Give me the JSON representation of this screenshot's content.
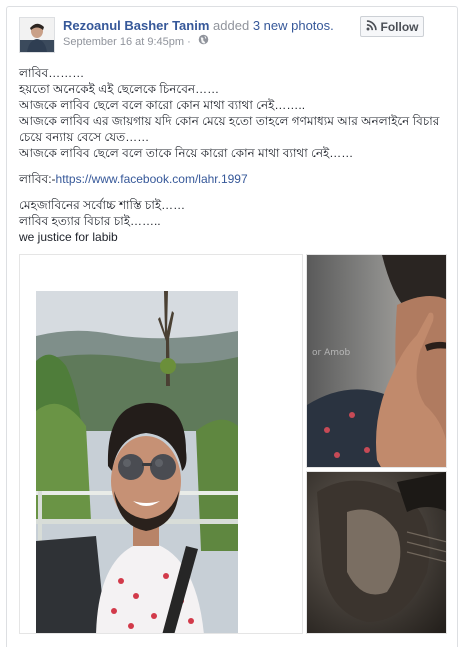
{
  "post": {
    "author": "Rezoanul Basher Tanim",
    "verb": "added",
    "photos_link": "3 new photos.",
    "timestamp": "September 16 at 9:45pm",
    "separator": "·",
    "follow_label": "Follow",
    "icons": {
      "avatar": "profile-photo",
      "globe": "globe-icon",
      "follow": "rss-icon"
    },
    "colors": {
      "link": "#365899",
      "meta": "#90949c"
    }
  },
  "body": {
    "line1": "লাবিব………",
    "line2": "হয়তো অনেকেই এই ছেলেকে চিনবেন……",
    "line3": "আজকে লাবিব ছেলে বলে কারো কোন মাথা ব্যাথা নেই……..",
    "line4": "আজকে লাবিব এর জায়গায় যদি কোন মেয়ে হতো তাহলে গণমাধ্যম আর অনলাইনে বিচার চেয়ে বন্যায় বেসে যেত……",
    "line5": "আজকে লাবিব ছেলে বলে তাকে নিয়ে কারো কোন মাথা ব্যাথা নেই……",
    "link_prefix": "লাবিব:-",
    "link_url": "https://www.facebook.com/lahr.1997",
    "line6": "মেহজাবিনের সর্বোচ্চ শাস্তি চাই……",
    "line7": "লাবিব হত্যার বিচার চাই……..",
    "line8": "we justice for labib"
  },
  "photos": [
    {
      "alt": "young man with sunglasses smiling in front of green hills"
    },
    {
      "alt": "close-up portrait with hand on face"
    },
    {
      "alt": "dark sepia portrait"
    }
  ]
}
